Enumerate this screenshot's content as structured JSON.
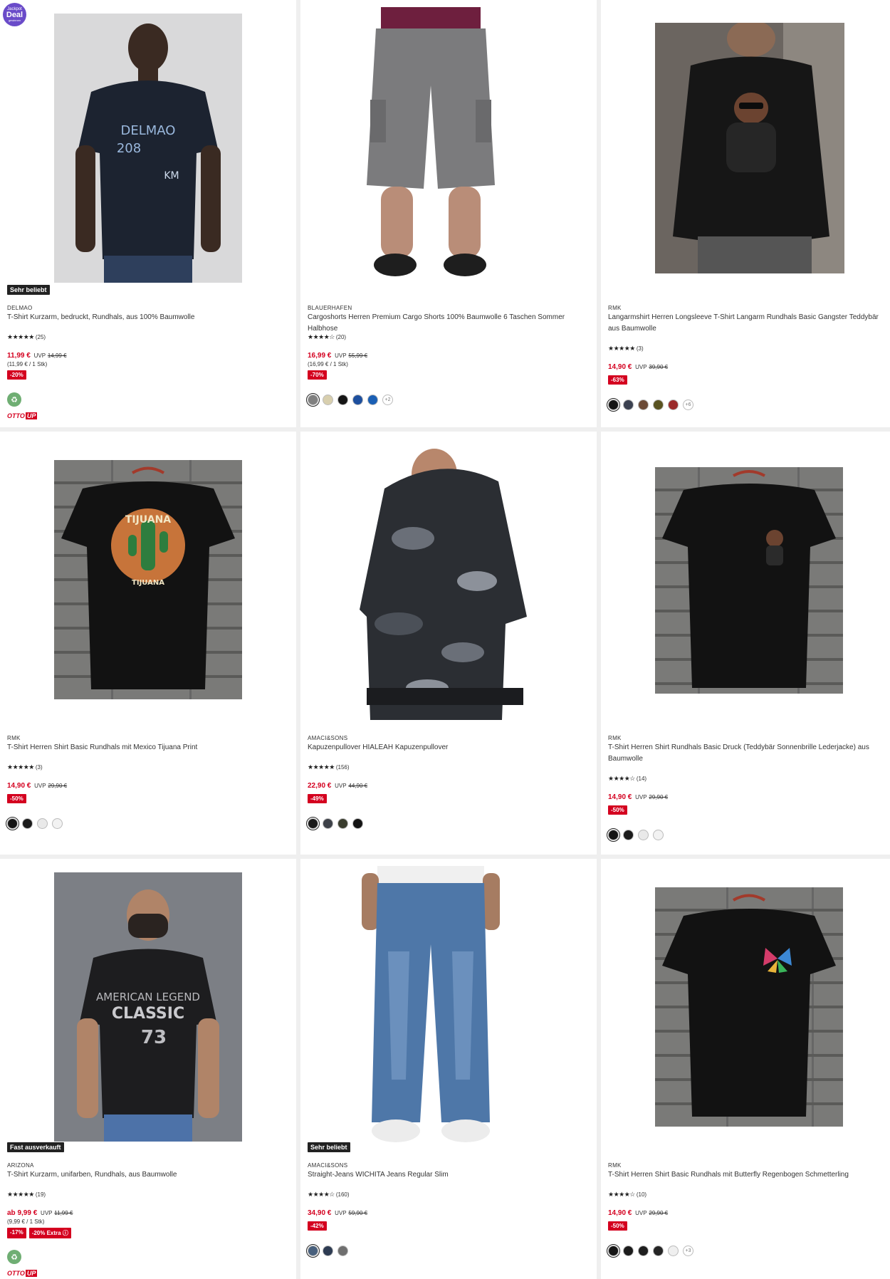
{
  "jackpot": {
    "line1": "Jackpot",
    "line2": "Deal",
    "line3": "gewinnen"
  },
  "products": [
    {
      "flag": "Sehr beliebt",
      "brand": "DELMAO",
      "title": "T-Shirt Kurzarm, bedruckt, Rundhals, aus 100% Baumwolle",
      "stars": "★★★★★",
      "reviews": "(25)",
      "price": "11,99 €",
      "uvp": "UVP",
      "old_price": "14,99 €",
      "unit_price": "(11,99 € / 1 Stk)",
      "badges": [
        "-20%"
      ],
      "swatches": [],
      "more": "",
      "eco": true,
      "ottoup": true
    },
    {
      "flag": "",
      "brand": "BLAUERHAFEN",
      "title": "Cargoshorts Herren Premium Cargo Shorts 100% Baumwolle 6 Taschen Sommer Halbhose",
      "stars": "★★★★☆",
      "reviews": "(20)",
      "price": "16,99 €",
      "uvp": "UVP",
      "old_price": "55,99 €",
      "unit_price": "(16,99 € / 1 Stk)",
      "badges": [
        "-70%"
      ],
      "swatches": [
        "#808080",
        "#d8cfae",
        "#151515",
        "#1d4f9e",
        "#1a5fb4"
      ],
      "more": "+2",
      "eco": false,
      "ottoup": false
    },
    {
      "flag": "",
      "brand": "RMK",
      "title": "Langarmshirt Herren Longsleeve T-Shirt Langarm Rundhals Basic Gangster Teddybär aus Baumwolle",
      "stars": "★★★★★",
      "reviews": "(3)",
      "price": "14,90 €",
      "uvp": "UVP",
      "old_price": "39,90 €",
      "unit_price": "",
      "badges": [
        "-63%"
      ],
      "swatches": [
        "#151515",
        "#3b4150",
        "#6b4a36",
        "#5a5321",
        "#9b2b2b"
      ],
      "more": "+6",
      "eco": false,
      "ottoup": false
    },
    {
      "flag": "",
      "brand": "RMK",
      "title": "T-Shirt Herren Shirt Basic Rundhals mit Mexico Tijuana Print",
      "stars": "★★★★★",
      "reviews": "(3)",
      "price": "14,90 €",
      "uvp": "UVP",
      "old_price": "29,90 €",
      "unit_price": "",
      "badges": [
        "-50%"
      ],
      "swatches": [
        "#151515",
        "#1c1c1c",
        "#e9e9e9",
        "#f2f2f2"
      ],
      "more": "",
      "eco": false,
      "ottoup": false
    },
    {
      "flag": "",
      "brand": "AMACI&SONS",
      "title": "Kapuzenpullover HIALEAH Kapuzenpullover",
      "stars": "★★★★★",
      "reviews": "(156)",
      "price": "22,90 €",
      "uvp": "UVP",
      "old_price": "44,90 €",
      "unit_price": "",
      "badges": [
        "-49%"
      ],
      "swatches": [
        "#1a1a1a",
        "#3d4148",
        "#3a3d2e",
        "#141414"
      ],
      "more": "",
      "eco": false,
      "ottoup": false
    },
    {
      "flag": "",
      "brand": "RMK",
      "title": "T-Shirt Herren Shirt Rundhals Basic Druck (Teddybär Sonnenbrille Lederjacke) aus Baumwolle",
      "stars": "★★★★☆",
      "reviews": "(14)",
      "price": "14,90 €",
      "uvp": "UVP",
      "old_price": "29,90 €",
      "unit_price": "",
      "badges": [
        "-50%"
      ],
      "swatches": [
        "#151515",
        "#1c1c1c",
        "#e9e9e9",
        "#f2f2f2"
      ],
      "more": "",
      "eco": false,
      "ottoup": false
    },
    {
      "flag": "Fast ausverkauft",
      "brand": "ARIZONA",
      "title": "T-Shirt Kurzarm, unifarben, Rundhals, aus Baumwolle",
      "stars": "★★★★★",
      "reviews": "(19)",
      "price": "ab 9,99 €",
      "uvp": "UVP",
      "old_price": "11,99 €",
      "unit_price": "(9,99 € / 1 Stk)",
      "badges": [
        "-17%",
        "-20% Extra ⓘ"
      ],
      "swatches": [],
      "more": "",
      "eco": true,
      "ottoup": true
    },
    {
      "flag": "Sehr beliebt",
      "brand": "AMACI&SONS",
      "title": "Straight-Jeans WICHITA Jeans Regular Slim",
      "stars": "★★★★☆",
      "reviews": "(160)",
      "price": "34,90 €",
      "uvp": "UVP",
      "old_price": "59,90 €",
      "unit_price": "",
      "badges": [
        "-42%"
      ],
      "swatches": [
        "#48607d",
        "#2d3b52",
        "#6f6f6f"
      ],
      "more": "",
      "eco": false,
      "ottoup": false
    },
    {
      "flag": "",
      "brand": "RMK",
      "title": "T-Shirt Herren Shirt Basic Rundhals mit Butterfly Regenbogen Schmetterling",
      "stars": "★★★★☆",
      "reviews": "(10)",
      "price": "14,90 €",
      "uvp": "UVP",
      "old_price": "29,90 €",
      "unit_price": "",
      "badges": [
        "-50%"
      ],
      "swatches": [
        "#151515",
        "#1c1c1c",
        "#1e1e1e",
        "#252525",
        "#efefef"
      ],
      "more": "+3",
      "eco": false,
      "ottoup": false
    }
  ]
}
